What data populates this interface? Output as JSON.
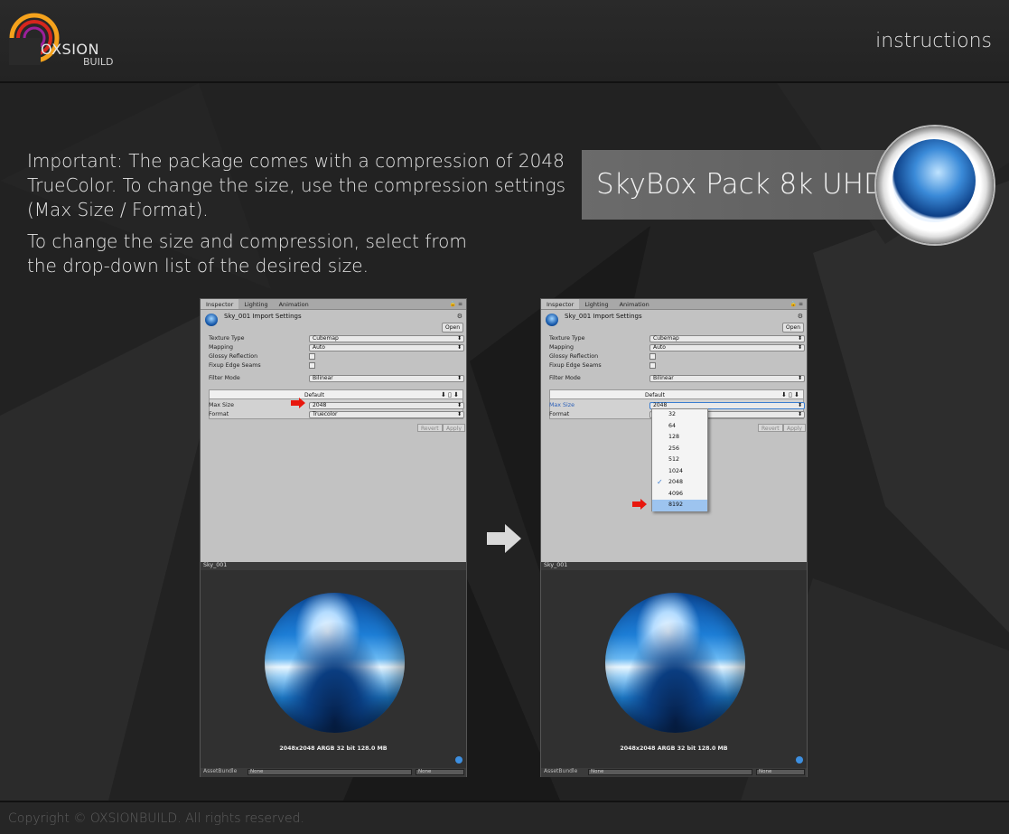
{
  "header": {
    "logo_line1": "OXSION",
    "logo_line2": "BUILD",
    "title": "instructions"
  },
  "intro": {
    "paragraph1": "Important: The package comes with a compression of 2048 TrueColor. To change the size, use the compression settings (Max Size / Format).",
    "paragraph2": "To change the size and compression, select from the drop-down list of the desired size."
  },
  "brand": {
    "title": "SkyBox Pack 8k UHD"
  },
  "inspector": {
    "tabs": [
      "Inspector",
      "Lighting",
      "Animation"
    ],
    "import_title": "Sky_001 Import Settings",
    "open_label": "Open",
    "rows": {
      "texture_type_label": "Texture Type",
      "texture_type_value": "Cubemap",
      "mapping_label": "Mapping",
      "mapping_value": "Auto",
      "glossy_label": "Glossy Reflection",
      "fixup_label": "Fixup Edge Seams",
      "filter_label": "Filter Mode",
      "filter_value": "Bilinear"
    },
    "platform_label": "Default",
    "max_size_label": "Max Size",
    "max_size_value": "2048",
    "format_label": "Format",
    "format_value": "Truecolor",
    "revert_label": "Revert",
    "apply_label": "Apply",
    "preview_name": "Sky_001",
    "preview_info": "2048x2048  ARGB 32 bit   128.0 MB",
    "assetbundle_label": "AssetBundle",
    "assetbundle_value": "None",
    "assetbundle_variant": "None"
  },
  "dropdown": {
    "options": [
      "32",
      "64",
      "128",
      "256",
      "512",
      "1024",
      "2048",
      "4096",
      "8192"
    ],
    "selected": "2048",
    "highlighted": "8192"
  },
  "footer": {
    "copyright": "Copyright © OXSIONBUILD. All rights reserved."
  },
  "colors": {
    "background": "#1e1e1e",
    "accent_red": "#e8170d",
    "dropdown_highlight": "#9dc4ef"
  }
}
